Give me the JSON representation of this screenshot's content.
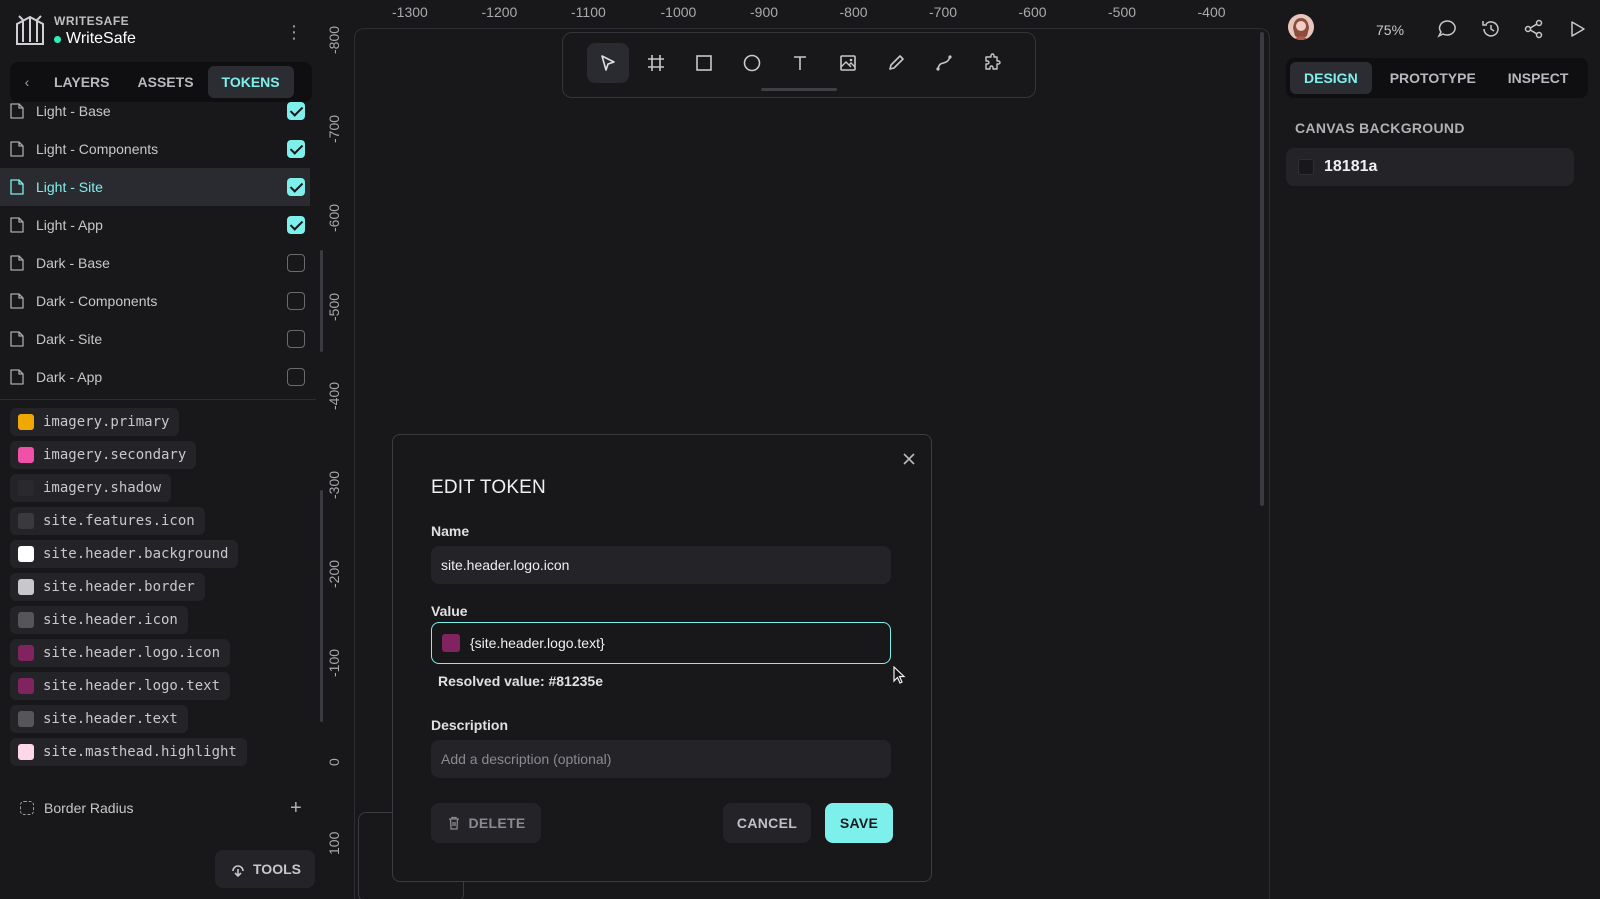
{
  "brand": {
    "top": "WRITESAFE",
    "name": "WriteSafe"
  },
  "left_tabs": [
    "LAYERS",
    "ASSETS",
    "TOKENS"
  ],
  "active_left_tab": "TOKENS",
  "token_sets": [
    {
      "label": "Light - Base",
      "checked": true,
      "active": false
    },
    {
      "label": "Light - Components",
      "checked": true,
      "active": false
    },
    {
      "label": "Light - Site",
      "checked": true,
      "active": true
    },
    {
      "label": "Light - App",
      "checked": true,
      "active": false
    },
    {
      "label": "Dark - Base",
      "checked": false,
      "active": false
    },
    {
      "label": "Dark - Components",
      "checked": false,
      "active": false
    },
    {
      "label": "Dark - Site",
      "checked": false,
      "active": false
    },
    {
      "label": "Dark - App",
      "checked": false,
      "active": false
    }
  ],
  "tokens": [
    {
      "label": "imagery.primary",
      "color": "#f0a800"
    },
    {
      "label": "imagery.secondary",
      "color": "#f050a8"
    },
    {
      "label": "imagery.shadow",
      "color": "#2a2a2e"
    },
    {
      "label": "site.features.icon",
      "color": "#3a3a3e"
    },
    {
      "label": "site.header.background",
      "color": "#ffffff"
    },
    {
      "label": "site.header.border",
      "color": "#c8c8cc"
    },
    {
      "label": "site.header.icon",
      "color": "#56565a"
    },
    {
      "label": "site.header.logo.icon",
      "color": "#81235e"
    },
    {
      "label": "site.header.logo.text",
      "color": "#81235e"
    },
    {
      "label": "site.header.text",
      "color": "#56565a"
    },
    {
      "label": "site.masthead.highlight",
      "color": "#ffd8e8"
    }
  ],
  "border_radius_label": "Border Radius",
  "tools_label": "TOOLS",
  "ruler_top": [
    "-1300",
    "-1200",
    "-1100",
    "-1000",
    "-900",
    "-800",
    "-700",
    "-600",
    "-500",
    "-400"
  ],
  "ruler_left": [
    "-800",
    "-700",
    "-600",
    "-500",
    "-400",
    "-300",
    "-200",
    "-100",
    "0",
    "100"
  ],
  "toolbar_tools": [
    "pointer-icon",
    "board-icon",
    "rectangle-icon",
    "ellipse-icon",
    "text-icon",
    "image-icon",
    "pencil-icon",
    "path-icon",
    "plugin-icon"
  ],
  "modal": {
    "title": "EDIT TOKEN",
    "name_label": "Name",
    "name_value": "site.header.logo.icon",
    "value_label": "Value",
    "value_text": "{site.header.logo.text}",
    "value_color": "#81235e",
    "resolved": "Resolved value: #81235e",
    "description_label": "Description",
    "description_placeholder": "Add a description (optional)",
    "delete_label": "DELETE",
    "cancel_label": "CANCEL",
    "save_label": "SAVE"
  },
  "zoom": "75%",
  "right_tabs": [
    "DESIGN",
    "PROTOTYPE",
    "INSPECT"
  ],
  "active_right_tab": "DESIGN",
  "canvas_background": {
    "title": "CANVAS BACKGROUND",
    "value": "18181a",
    "color": "#18181a"
  },
  "colors": {
    "accent": "#7ef0ec",
    "background": "#18181a",
    "panel": "#232328"
  }
}
